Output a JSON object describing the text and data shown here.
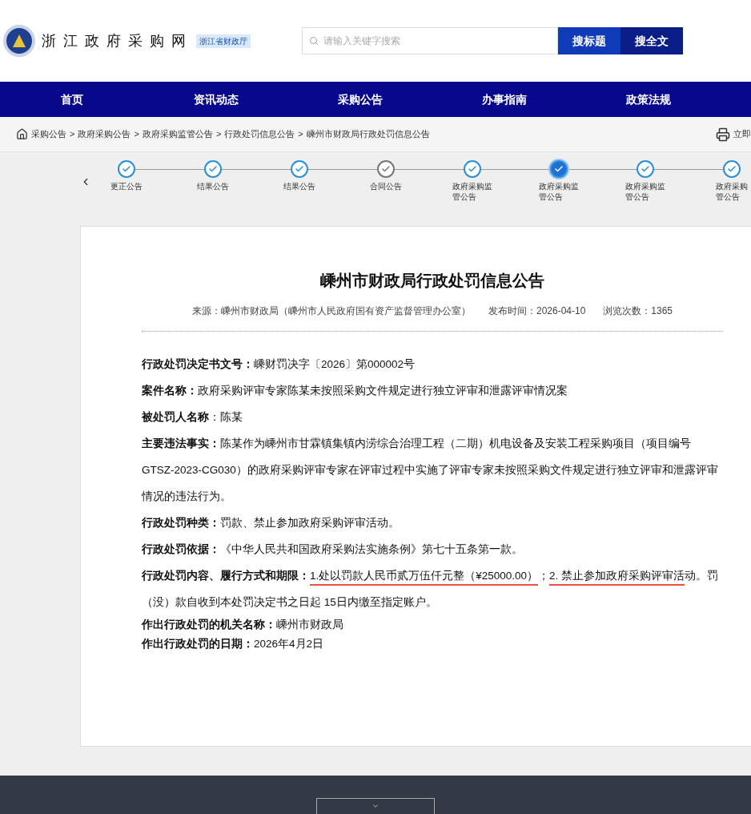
{
  "header": {
    "site_name": "浙江政府采购网",
    "badge": "浙江省财政厅",
    "search": {
      "placeholder": "请输入关键字搜索"
    },
    "buttons": [
      "搜标题",
      "搜全文"
    ]
  },
  "nav": [
    "首页",
    "资讯动态",
    "采购公告",
    "办事指南",
    "政策法规"
  ],
  "breadcrumb": {
    "items": [
      "采购公告",
      "政府采购公告",
      "政府采购监管公告",
      "行政处罚信息公告",
      "嵊州市财政局行政处罚信息公告"
    ],
    "separator": ">",
    "print": "立即"
  },
  "steps": [
    {
      "lines": [
        "更正公告"
      ],
      "done": true,
      "current": false
    },
    {
      "lines": [
        "结果公告"
      ],
      "done": true,
      "current": false
    },
    {
      "lines": [
        "结果公告"
      ],
      "done": true,
      "current": false
    },
    {
      "lines": [
        "合同公告"
      ],
      "done": false,
      "current": false
    },
    {
      "lines": [
        "政府采购监",
        "管公告"
      ],
      "done": true,
      "current": false
    },
    {
      "lines": [
        "政府采购监",
        "管公告"
      ],
      "done": true,
      "current": true
    },
    {
      "lines": [
        "政府采购监",
        "管公告"
      ],
      "done": true,
      "current": false
    },
    {
      "lines": [
        "政府采购",
        "管公告"
      ],
      "done": true,
      "current": false
    }
  ],
  "article": {
    "title": "嵊州市财政局行政处罚信息公告",
    "source": "来源：嵊州市财政局（嵊州市人民政府国有资产监督管理办公室）",
    "published": "发布时间：2026-04-10",
    "views": "浏览次数：1365",
    "fields": [
      {
        "label": "行政处罚决定书文号：",
        "parts": [
          {
            "text": "嵊财罚决字〔2026〕第000002号",
            "underlined": false
          }
        ]
      },
      {
        "label": "案件名称：",
        "parts": [
          {
            "text": "政府采购评审专家陈某未按照采购文件规定进行独立评审和泄露评审情况案",
            "underlined": false
          }
        ]
      },
      {
        "label": "被处罚人名称",
        "parts": [
          {
            "text": "：陈某",
            "underlined": false
          }
        ]
      },
      {
        "label": "主要违法事实：",
        "parts": [
          {
            "text": "陈某作为嵊州市甘霖镇集镇内涝综合治理工程（二期）机电设备及安装工程采购项目（项目编号GTSZ-2023-CG030）的政府采购评审专家在评审过程中实施了评审专家未按照采购文件规定进行独立评审和泄露评审情况的违法行为。",
            "underlined": false
          }
        ]
      },
      {
        "label": "行政处罚种类：",
        "parts": [
          {
            "text": "罚款、禁止参加政府采购评审活动。",
            "underlined": false
          }
        ]
      },
      {
        "label": "行政处罚依据：",
        "parts": [
          {
            "text": "《中华人民共和国政府采购法实施条例》第七十五条第一款。",
            "underlined": false
          }
        ]
      },
      {
        "label": "行政处罚内容、履行方式和期限：",
        "parts": [
          {
            "text": "1.处以罚款人民币贰万伍仟元整（¥25000.00）",
            "underlined": true
          },
          {
            "text": "；",
            "underlined": false
          },
          {
            "text": "2. 禁止参加政府采购评审活",
            "underlined": true
          },
          {
            "text": "动。罚（没）款自收到本处罚决定书之日起 15日内缴至指定账户。",
            "underlined": false
          }
        ]
      }
    ],
    "closing_fields": [
      {
        "label": "作出行政处罚的机关名称：",
        "value": "嵊州市财政局"
      },
      {
        "label": "作出行政处罚的日期：",
        "value": "2026年4月2日"
      }
    ]
  }
}
